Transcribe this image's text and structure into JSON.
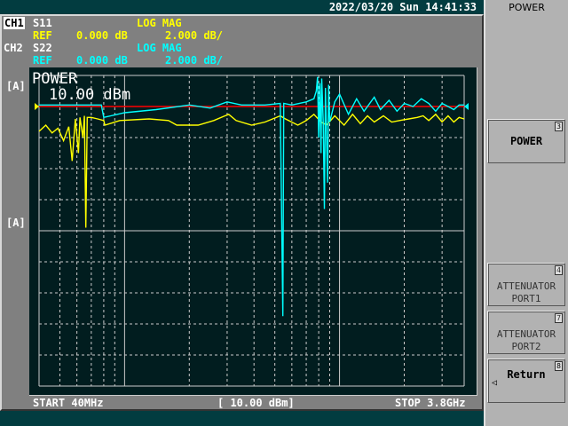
{
  "datetime": "2022/03/20 Sun 14:41:33",
  "ch1": {
    "label": "CH1",
    "param": "S11",
    "format": "LOG MAG",
    "ref": "REF",
    "ref_value": "0.000 dB",
    "scale": "2.000 dB/"
  },
  "ch2": {
    "label": "CH2",
    "param": "S22",
    "format": "LOG MAG",
    "ref": "REF",
    "ref_value": "0.000 dB",
    "scale": "2.000 dB/"
  },
  "marker_labels": [
    "[A]",
    "[A]"
  ],
  "overlay": {
    "title": "POWER",
    "value": "10.00 dBm"
  },
  "status": {
    "start": "START 40MHz",
    "center": "[ 10.00 dBm]",
    "stop": "STOP 3.8GHz"
  },
  "softkeys": {
    "title": "POWER",
    "items": [
      {
        "label": "POWER",
        "num": "3"
      },
      {
        "label": "ATTENUATOR\nPORT1",
        "num": "4"
      },
      {
        "label": "ATTENUATOR\nPORT2",
        "num": "7"
      },
      {
        "label": "Return",
        "num": "8",
        "arrow": "◁"
      }
    ]
  },
  "colors": {
    "ch1": "#ffff00",
    "ch2": "#00ffff",
    "ref_line": "#ff0000"
  },
  "chart_data": {
    "type": "line",
    "x_scale": "log",
    "xlim_mhz": [
      40,
      3800
    ],
    "ylim_db": [
      -14,
      2
    ],
    "ref_db": 0,
    "series": [
      {
        "name": "S11",
        "points": [
          [
            40,
            -1.6
          ],
          [
            43,
            -1.2
          ],
          [
            46,
            -1.7
          ],
          [
            49,
            -1.4
          ],
          [
            52,
            -2.2
          ],
          [
            55,
            -1.3
          ],
          [
            57,
            -3.5
          ],
          [
            59,
            -0.8
          ],
          [
            61,
            -3
          ],
          [
            62,
            -0.7
          ],
          [
            64,
            -2
          ],
          [
            65,
            -0.6
          ],
          [
            66,
            -7.8
          ],
          [
            67,
            -0.7
          ],
          [
            70,
            -0.7
          ],
          [
            75,
            -0.8
          ],
          [
            80,
            -0.9
          ],
          [
            81,
            -1.2
          ],
          [
            95,
            -0.9
          ],
          [
            130,
            -0.8
          ],
          [
            160,
            -0.9
          ],
          [
            175,
            -1.2
          ],
          [
            220,
            -1.2
          ],
          [
            260,
            -0.9
          ],
          [
            305,
            -0.5
          ],
          [
            330,
            -0.9
          ],
          [
            390,
            -1.2
          ],
          [
            450,
            -1
          ],
          [
            530,
            -0.6
          ],
          [
            560,
            -0.8
          ],
          [
            640,
            -1.2
          ],
          [
            700,
            -0.9
          ],
          [
            760,
            -0.5
          ],
          [
            820,
            -1
          ],
          [
            870,
            -1.2
          ],
          [
            950,
            -0.6
          ],
          [
            1050,
            -1.2
          ],
          [
            1150,
            -0.5
          ],
          [
            1250,
            -1.1
          ],
          [
            1350,
            -0.6
          ],
          [
            1450,
            -1
          ],
          [
            1600,
            -0.6
          ],
          [
            1750,
            -1
          ],
          [
            1900,
            -0.9
          ],
          [
            2100,
            -0.8
          ],
          [
            2300,
            -0.7
          ],
          [
            2450,
            -0.6
          ],
          [
            2600,
            -0.9
          ],
          [
            2800,
            -0.5
          ],
          [
            3000,
            -1
          ],
          [
            3200,
            -0.6
          ],
          [
            3400,
            -1
          ],
          [
            3600,
            -0.7
          ],
          [
            3800,
            -0.8
          ]
        ]
      },
      {
        "name": "S22",
        "points": [
          [
            40,
            0.1
          ],
          [
            78,
            0.1
          ],
          [
            80,
            -0.7
          ],
          [
            100,
            -0.4
          ],
          [
            140,
            -0.2
          ],
          [
            200,
            0.1
          ],
          [
            250,
            -0.1
          ],
          [
            300,
            0.3
          ],
          [
            350,
            0.1
          ],
          [
            450,
            0.1
          ],
          [
            530,
            0.2
          ],
          [
            545,
            -13.5
          ],
          [
            550,
            0.2
          ],
          [
            600,
            0.1
          ],
          [
            700,
            0.3
          ],
          [
            760,
            0.5
          ],
          [
            780,
            1
          ],
          [
            790,
            1.9
          ],
          [
            800,
            -2
          ],
          [
            810,
            1.5
          ],
          [
            820,
            -3
          ],
          [
            826,
            1.8
          ],
          [
            840,
            -1
          ],
          [
            850,
            -6.6
          ],
          [
            860,
            1.2
          ],
          [
            880,
            -4.9
          ],
          [
            890,
            1.4
          ],
          [
            900,
            -1
          ],
          [
            950,
            0.3
          ],
          [
            1000,
            0.8
          ],
          [
            1100,
            -0.5
          ],
          [
            1200,
            0.5
          ],
          [
            1300,
            -0.3
          ],
          [
            1450,
            0.6
          ],
          [
            1550,
            -0.2
          ],
          [
            1700,
            0.4
          ],
          [
            1850,
            -0.3
          ],
          [
            2000,
            0.2
          ],
          [
            2200,
            0
          ],
          [
            2400,
            0.5
          ],
          [
            2600,
            0.2
          ],
          [
            2800,
            -0.3
          ],
          [
            3000,
            0.2
          ],
          [
            3200,
            0
          ],
          [
            3400,
            -0.2
          ],
          [
            3600,
            0.1
          ],
          [
            3800,
            0.1
          ]
        ]
      }
    ]
  }
}
